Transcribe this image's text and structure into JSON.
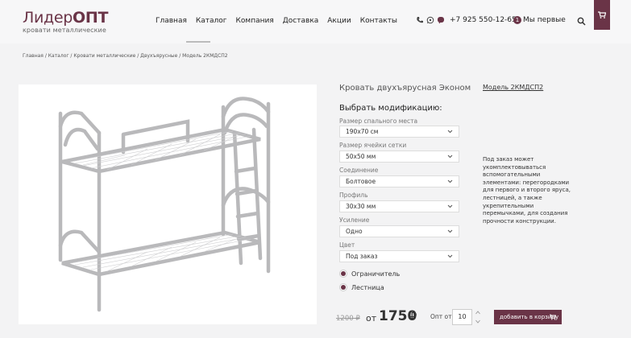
{
  "logo": {
    "brand_main": "Лидер",
    "brand_bold": "ОПТ",
    "tagline": "кровати металлические"
  },
  "nav": {
    "items": [
      "Главная",
      "Каталог",
      "Компания",
      "Доставка",
      "Акции",
      "Контакты"
    ]
  },
  "contacts": {
    "phone": "+7 925 550-12-65"
  },
  "badge": {
    "count": "1",
    "label": "Мы первые"
  },
  "breadcrumb": "Главная / Каталог / Кровати металлические  /  Двухъярусные / Модель 2КМДСП2",
  "product": {
    "title": "Кровать двухъярусная  Эконом",
    "model": "Модель 2КМДСП2",
    "choose_label": "Выбрать модификацию:"
  },
  "fields": [
    {
      "label": "Размер спального места",
      "value": "190х70 см"
    },
    {
      "label": "Размер ячейки сетки",
      "value": "50х50 мм"
    },
    {
      "label": "Соединение",
      "value": "Болтовое"
    },
    {
      "label": "Профиль",
      "value": "30х30 мм"
    },
    {
      "label": "Усиление",
      "value": "Одно"
    },
    {
      "label": "Цвет",
      "value": "Под заказ"
    }
  ],
  "checks": [
    {
      "label": "Ограничитель",
      "checked": true
    },
    {
      "label": "Лестница",
      "checked": true
    }
  ],
  "note": "Под заказ может укомплектовываться вспомогательными элементами: перегородками для первого и второго яруса, лестницей, а также укрепительными перемычками, для создания прочности конструкции.",
  "price": {
    "old": "1200 ₽",
    "from": "от",
    "value": "1750",
    "currency": "₽"
  },
  "qty": {
    "label": "Опт от",
    "value": "10"
  },
  "cart_button": "добавить в корзину",
  "colors": {
    "accent": "#6a3447",
    "background": "#f3f3f4"
  }
}
